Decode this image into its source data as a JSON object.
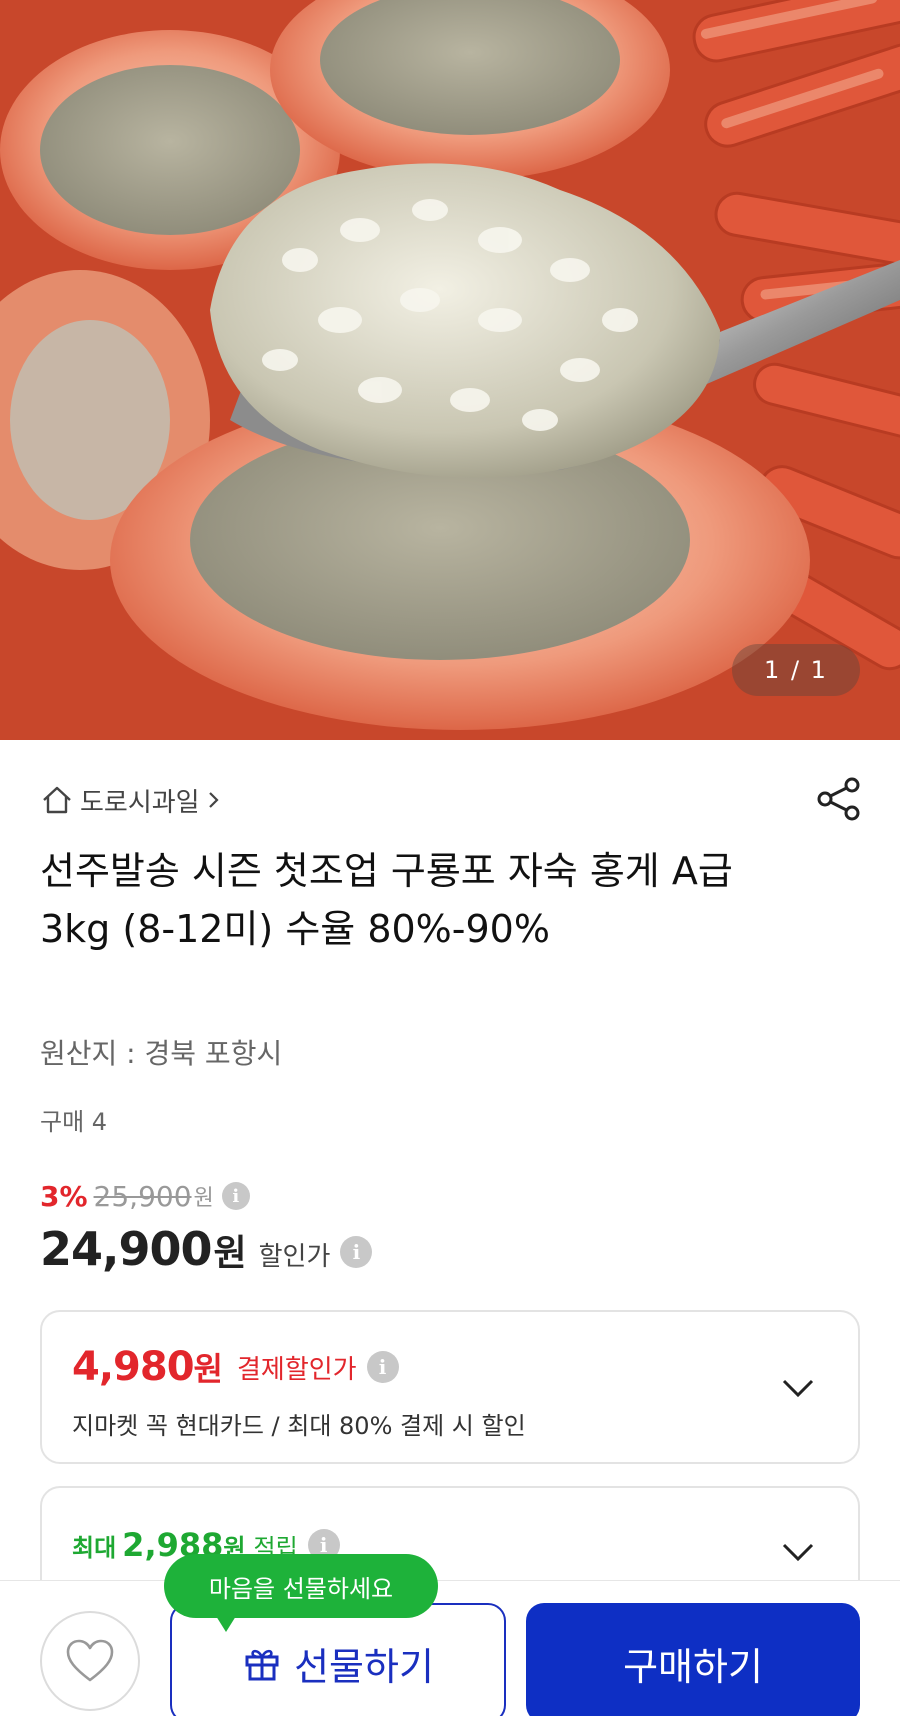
{
  "hero": {
    "image_counter": "1 / 1"
  },
  "store": {
    "name": "도로시과일",
    "home_icon": "home-icon",
    "chevron_icon": "chevron-right-icon"
  },
  "share_icon": "share-icon",
  "product": {
    "title": "선주발송 시즌 첫조업 구룡포 자숙 홍게 A급 3kg (8-12미) 수율 80%-90%",
    "origin": "원산지 : 경북 포항시",
    "purchase_count": "구매 4"
  },
  "pricing": {
    "discount_percent": "3%",
    "original_price": "25,900",
    "original_currency": "원",
    "sale_price": "24,900",
    "sale_currency": "원",
    "sale_label": "할인가",
    "info_glyph": "i"
  },
  "payment_card": {
    "amount": "4,980",
    "currency": "원",
    "label": "결제할인가",
    "description": "지마켓 꼭 현대카드 / 최대 80% 결제 시 할인",
    "chevron_icon": "chevron-down-icon"
  },
  "reward_card": {
    "prefix": "최대",
    "amount": "2,988",
    "currency": "원",
    "suffix": "적립",
    "chevron_icon": "chevron-down-icon"
  },
  "bottom_bar": {
    "gift_tooltip": "마음을 선물하세요",
    "gift_label": "선물하기",
    "buy_label": "구매하기",
    "favorite_icon": "heart-icon",
    "gift_icon": "gift-icon"
  },
  "colors": {
    "discount_red": "#e2262c",
    "reward_green": "#1ea832",
    "brand_blue": "#0e2fc4"
  }
}
